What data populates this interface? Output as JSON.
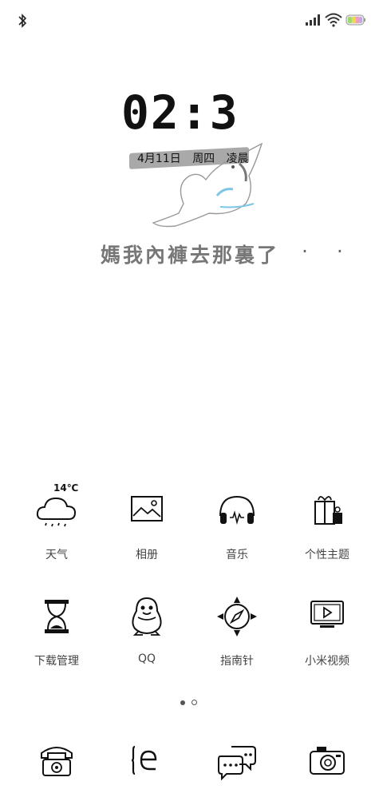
{
  "status_bar": {
    "left_icon": "bluetooth-icon",
    "right_icons": [
      "signal-icon",
      "wifi-icon",
      "battery-icon"
    ]
  },
  "lockscreen": {
    "time": "02:3",
    "date": "4月11日",
    "weekday": "周四",
    "period": "凌晨",
    "slogan": "媽我內褲去那裏了",
    "slogan_trail": "· ·"
  },
  "apps": [
    {
      "label": "天气",
      "icon": "weather-cloud-icon",
      "badge": "14℃"
    },
    {
      "label": "相册",
      "icon": "gallery-icon"
    },
    {
      "label": "音乐",
      "icon": "headphones-icon"
    },
    {
      "label": "个性主题",
      "icon": "gift-theme-icon"
    },
    {
      "label": "下载管理",
      "icon": "hourglass-icon"
    },
    {
      "label": "QQ",
      "icon": "penguin-icon"
    },
    {
      "label": "指南针",
      "icon": "compass-icon"
    },
    {
      "label": "小米视频",
      "icon": "video-tv-icon"
    }
  ],
  "pager": {
    "pages": 2,
    "current": 1
  },
  "dock": [
    {
      "icon": "phone-icon"
    },
    {
      "icon": "browser-icon"
    },
    {
      "icon": "messages-icon"
    },
    {
      "icon": "camera-icon"
    }
  ]
}
